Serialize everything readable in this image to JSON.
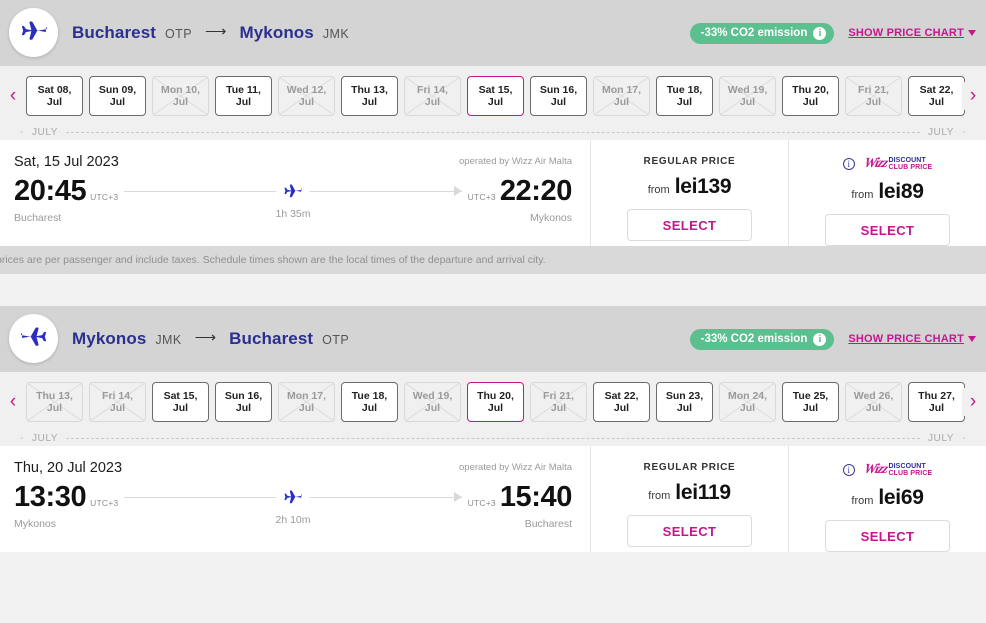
{
  "journeys": [
    {
      "id": "outbound",
      "direction": "right",
      "plane_icon": "airplane-icon",
      "origin_city": "Bucharest",
      "origin_code": "OTP",
      "arrow": "⟶",
      "destination_city": "Mykonos",
      "destination_code": "JMK",
      "co2_badge": "-33% CO2 emission",
      "co2_info_icon": "info-icon",
      "price_chart_link": "SHOW PRICE CHART",
      "chevron_icon": "chevron-down-icon",
      "prev_icon": "chevron-left-icon",
      "next_icon": "chevron-right-icon",
      "month_label_left": "JULY",
      "month_label_right": "JULY",
      "dates": [
        {
          "day": "Sat 08,",
          "month": "Jul",
          "state": "available"
        },
        {
          "day": "Sun 09,",
          "month": "Jul",
          "state": "available"
        },
        {
          "day": "Mon 10,",
          "month": "Jul",
          "state": "disabled"
        },
        {
          "day": "Tue 11,",
          "month": "Jul",
          "state": "available"
        },
        {
          "day": "Wed 12,",
          "month": "Jul",
          "state": "disabled"
        },
        {
          "day": "Thu 13,",
          "month": "Jul",
          "state": "available"
        },
        {
          "day": "Fri 14,",
          "month": "Jul",
          "state": "disabled"
        },
        {
          "day": "Sat 15,",
          "month": "Jul",
          "state": "selected"
        },
        {
          "day": "Sun 16,",
          "month": "Jul",
          "state": "available"
        },
        {
          "day": "Mon 17,",
          "month": "Jul",
          "state": "disabled"
        },
        {
          "day": "Tue 18,",
          "month": "Jul",
          "state": "available"
        },
        {
          "day": "Wed 19,",
          "month": "Jul",
          "state": "disabled"
        },
        {
          "day": "Thu 20,",
          "month": "Jul",
          "state": "available"
        },
        {
          "day": "Fri 21,",
          "month": "Jul",
          "state": "disabled"
        },
        {
          "day": "Sat 22,",
          "month": "Jul",
          "state": "available"
        }
      ],
      "flight": {
        "date": "Sat, 15 Jul 2023",
        "operated_by": "operated by Wizz Air Malta",
        "depart_time": "20:45",
        "depart_utc": "UTC+3",
        "depart_city": "Bucharest",
        "arrive_time": "22:20",
        "arrive_utc": "UTC+3",
        "arrive_city": "Mykonos",
        "duration": "1h 35m"
      },
      "fares": [
        {
          "type": "regular",
          "title": "REGULAR PRICE",
          "from_label": "from",
          "amount": "lei139",
          "select_label": "SELECT"
        },
        {
          "type": "club",
          "info_icon": "info-icon",
          "logo_wizz": "Wizz",
          "logo_line1": "DISCOUNT",
          "logo_line2": "CLUB PRICE",
          "from_label": "from",
          "amount": "lei89",
          "select_label": "SELECT"
        }
      ]
    },
    {
      "id": "return",
      "direction": "left",
      "plane_icon": "airplane-icon",
      "origin_city": "Mykonos",
      "origin_code": "JMK",
      "arrow": "⟶",
      "destination_city": "Bucharest",
      "destination_code": "OTP",
      "co2_badge": "-33% CO2 emission",
      "co2_info_icon": "info-icon",
      "price_chart_link": "SHOW PRICE CHART",
      "chevron_icon": "chevron-down-icon",
      "prev_icon": "chevron-left-icon",
      "next_icon": "chevron-right-icon",
      "month_label_left": "JULY",
      "month_label_right": "JULY",
      "dates": [
        {
          "day": "Thu 13,",
          "month": "Jul",
          "state": "disabled"
        },
        {
          "day": "Fri 14,",
          "month": "Jul",
          "state": "disabled"
        },
        {
          "day": "Sat 15,",
          "month": "Jul",
          "state": "available"
        },
        {
          "day": "Sun 16,",
          "month": "Jul",
          "state": "available"
        },
        {
          "day": "Mon 17,",
          "month": "Jul",
          "state": "disabled"
        },
        {
          "day": "Tue 18,",
          "month": "Jul",
          "state": "available"
        },
        {
          "day": "Wed 19,",
          "month": "Jul",
          "state": "disabled"
        },
        {
          "day": "Thu 20,",
          "month": "Jul",
          "state": "selected"
        },
        {
          "day": "Fri 21,",
          "month": "Jul",
          "state": "disabled"
        },
        {
          "day": "Sat 22,",
          "month": "Jul",
          "state": "available"
        },
        {
          "day": "Sun 23,",
          "month": "Jul",
          "state": "available"
        },
        {
          "day": "Mon 24,",
          "month": "Jul",
          "state": "disabled"
        },
        {
          "day": "Tue 25,",
          "month": "Jul",
          "state": "available"
        },
        {
          "day": "Wed 26,",
          "month": "Jul",
          "state": "disabled"
        },
        {
          "day": "Thu 27,",
          "month": "Jul",
          "state": "available"
        }
      ],
      "flight": {
        "date": "Thu, 20 Jul 2023",
        "operated_by": "operated by Wizz Air Malta",
        "depart_time": "13:30",
        "depart_utc": "UTC+3",
        "depart_city": "Mykonos",
        "arrive_time": "15:40",
        "arrive_utc": "UTC+3",
        "arrive_city": "Bucharest",
        "duration": "2h 10m"
      },
      "fares": [
        {
          "type": "regular",
          "title": "REGULAR PRICE",
          "from_label": "from",
          "amount": "lei119",
          "select_label": "SELECT"
        },
        {
          "type": "club",
          "info_icon": "info-icon",
          "logo_wizz": "Wizz",
          "logo_line1": "DISCOUNT",
          "logo_line2": "CLUB PRICE",
          "from_label": "from",
          "amount": "lei69",
          "select_label": "SELECT"
        }
      ]
    }
  ],
  "disclaimer": "prices are per passenger and include taxes. Schedule times shown are the local times of the departure and arrival city.",
  "colors": {
    "brand_pink": "#c6168d",
    "brand_navy": "#2b2f8f",
    "co2_green": "#5cbf8f",
    "header_bg": "#d4d4d4",
    "page_bg": "#f2f2f2"
  }
}
